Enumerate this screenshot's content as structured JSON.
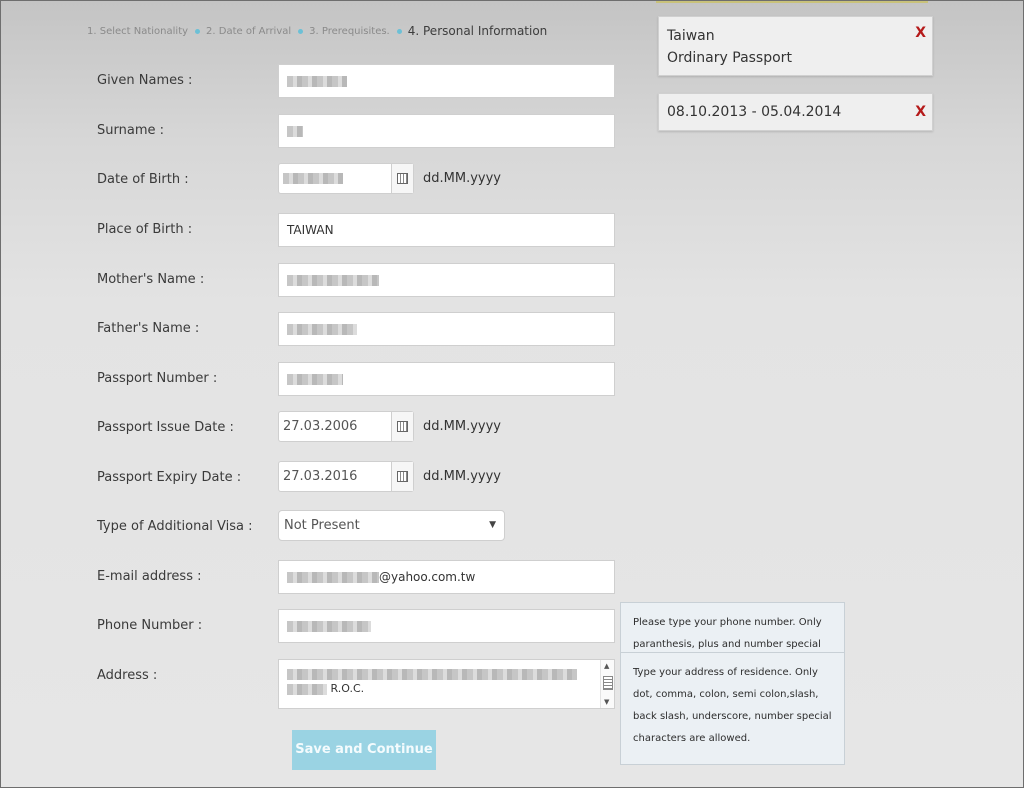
{
  "steps": [
    {
      "label": "1. Select Nationality",
      "active": false
    },
    {
      "label": "2. Date of Arrival",
      "active": false
    },
    {
      "label": "3. Prerequisites.",
      "active": false
    },
    {
      "label": "4. Personal Information",
      "active": true
    }
  ],
  "form": {
    "given_names": {
      "label": "Given Names :",
      "value": ""
    },
    "surname": {
      "label": "Surname :",
      "value": ""
    },
    "date_of_birth": {
      "label": "Date of Birth :",
      "value": "",
      "format": "dd.MM.yyyy"
    },
    "place_of_birth": {
      "label": "Place of Birth :",
      "value": "TAIWAN"
    },
    "mothers_name": {
      "label": "Mother's Name :",
      "value": ""
    },
    "fathers_name": {
      "label": "Father's Name :",
      "value": ""
    },
    "passport_number": {
      "label": "Passport Number :",
      "value": ""
    },
    "passport_issue_date": {
      "label": "Passport Issue Date :",
      "value": "27.03.2006",
      "format": "dd.MM.yyyy"
    },
    "passport_expiry_date": {
      "label": "Passport Expiry Date :",
      "value": "27.03.2016",
      "format": "dd.MM.yyyy"
    },
    "additional_visa": {
      "label": "Type of Additional Visa :",
      "value": "Not Present"
    },
    "email": {
      "label": "E-mail address :",
      "value": "@yahoo.com.tw"
    },
    "phone": {
      "label": "Phone Number :",
      "value": ""
    },
    "address": {
      "label": "Address :",
      "value": "R.O.C."
    },
    "save_label": "Save and Continue"
  },
  "summary": {
    "nationality": {
      "country": "Taiwan",
      "document": "Ordinary Passport",
      "remove": "X"
    },
    "dates": {
      "range": "08.10.2013 - 05.04.2014",
      "remove": "X"
    }
  },
  "tooltips": {
    "phone": [
      "Please type your phone number. Only",
      "paranthesis, plus and number special"
    ],
    "address": [
      "Type your address of residence. Only",
      "dot, comma, colon, semi colon,slash,",
      "back slash, underscore, number special",
      "characters are allowed."
    ]
  },
  "colors": {
    "accent": "#9ad3e3",
    "step_dot": "#6cc0d6",
    "remove": "#b51a1a"
  }
}
